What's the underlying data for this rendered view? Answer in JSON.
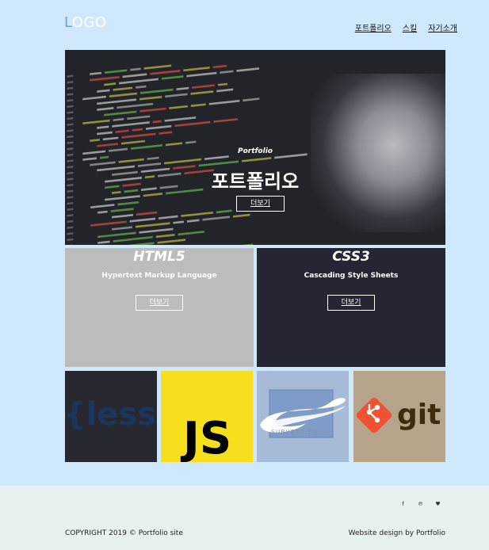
{
  "header": {
    "logo_first": "L",
    "logo_rest": "OGO",
    "nav": [
      "포트폴리오",
      "스킬",
      "자기소개"
    ]
  },
  "hero": {
    "subtitle": "Portfolio",
    "title": "포트폴리오",
    "button": "더보기"
  },
  "cards": [
    {
      "title": "HTML5",
      "desc": "Hypertext Markup Language",
      "button": "더보기"
    },
    {
      "title": "CSS3",
      "desc": "Cascading Style Sheets",
      "button": "더보기"
    }
  ],
  "tiles": {
    "less": "{less}",
    "js": "JS",
    "svn": "SUBVERSION",
    "git": "git"
  },
  "footer": {
    "social": [
      "f",
      "℗",
      "♥"
    ],
    "copyright": "COPYRIGHT 2019 © Portfolio site",
    "credit": "Website design by Portfolio"
  },
  "colors": {
    "background": "#cfe8fb",
    "html_card": "#bcbcbc",
    "css_card": "#252631",
    "js_yellow": "#f7df1e",
    "git_orange": "#f05133"
  }
}
